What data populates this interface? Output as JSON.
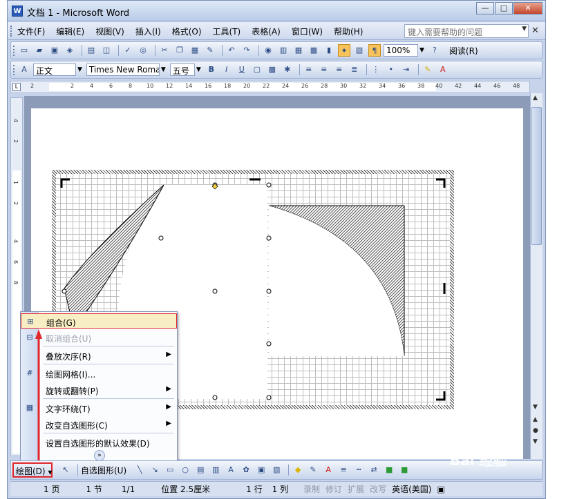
{
  "window": {
    "title": "文档 1 - Microsoft Word",
    "app_icon": "W",
    "controls": [
      "—",
      "□",
      "✕"
    ]
  },
  "menubar": {
    "items": [
      "文件(F)",
      "编辑(E)",
      "视图(V)",
      "插入(I)",
      "格式(O)",
      "工具(T)",
      "表格(A)",
      "窗口(W)",
      "帮助(H)"
    ],
    "help_placeholder": "键入需要帮助的问题",
    "close_glyph": "✕"
  },
  "toolbar_standard": {
    "icons": [
      "new-icon",
      "open-icon",
      "save-icon",
      "permission-icon",
      "print-icon",
      "print-preview-icon",
      "spelling-icon",
      "research-icon",
      "cut-icon",
      "copy-icon",
      "paste-icon",
      "format-painter-icon",
      "undo-icon",
      "redo-icon",
      "hyperlink-icon",
      "tables-borders-icon",
      "insert-table-icon",
      "insert-excel-icon",
      "columns-icon",
      "drawing-icon",
      "document-map-icon",
      "show-hide-icon"
    ],
    "zoom_value": "100%",
    "read_label": "阅读(R)"
  },
  "toolbar_formatting": {
    "style_value": "正文",
    "font_value": "Times New Roman",
    "size_value": "五号",
    "bold": "B",
    "italic": "I",
    "underline": "U"
  },
  "ruler_h": {
    "ticks": [
      "2",
      "2",
      "4",
      "6",
      "8",
      "10",
      "12",
      "14",
      "16",
      "18",
      "20",
      "22",
      "24",
      "26",
      "28",
      "30",
      "32",
      "34",
      "36",
      "38",
      "40",
      "42",
      "44",
      "46",
      "48"
    ]
  },
  "ruler_v": {
    "ticks": [
      "4",
      "2",
      "1",
      "2",
      "4",
      "6",
      "8"
    ]
  },
  "drawing_toolbar": {
    "draw_label": "绘图(D)",
    "autoshape_label": "自选图形(U)"
  },
  "context_menu": {
    "items": [
      {
        "label": "组合(G)",
        "icon": "group-icon",
        "state": "highlighted",
        "submenu": false
      },
      {
        "label": "取消组合(U)",
        "icon": "ungroup-icon",
        "state": "disabled",
        "submenu": false
      },
      {
        "label": "叠放次序(R)",
        "icon": "",
        "state": "normal",
        "submenu": true
      },
      {
        "label": "绘图网格(I)...",
        "icon": "grid-icon",
        "state": "normal",
        "submenu": false
      },
      {
        "label": "旋转或翻转(P)",
        "icon": "",
        "state": "normal",
        "submenu": true
      },
      {
        "label": "文字环绕(T)",
        "icon": "text-wrap-icon",
        "state": "normal",
        "submenu": true
      },
      {
        "label": "改变自选图形(C)",
        "icon": "",
        "state": "normal",
        "submenu": true
      },
      {
        "label": "设置自选图形的默认效果(D)",
        "icon": "",
        "state": "normal",
        "submenu": false
      }
    ],
    "more_glyph": "»"
  },
  "statusbar": {
    "page": "1 页",
    "section": "1 节",
    "page_of": "1/1",
    "position": "位置 2.5厘米",
    "line": "1 行",
    "column": "1 列",
    "rec": "录制",
    "trk": "修订",
    "ext": "扩展",
    "ovr": "改写",
    "language": "英语(美国)"
  },
  "watermark": "Bai 经验",
  "colors": {
    "highlight": "#f8eec3",
    "red_outline": "#e0262b",
    "chrome": "#c6d3ea"
  }
}
